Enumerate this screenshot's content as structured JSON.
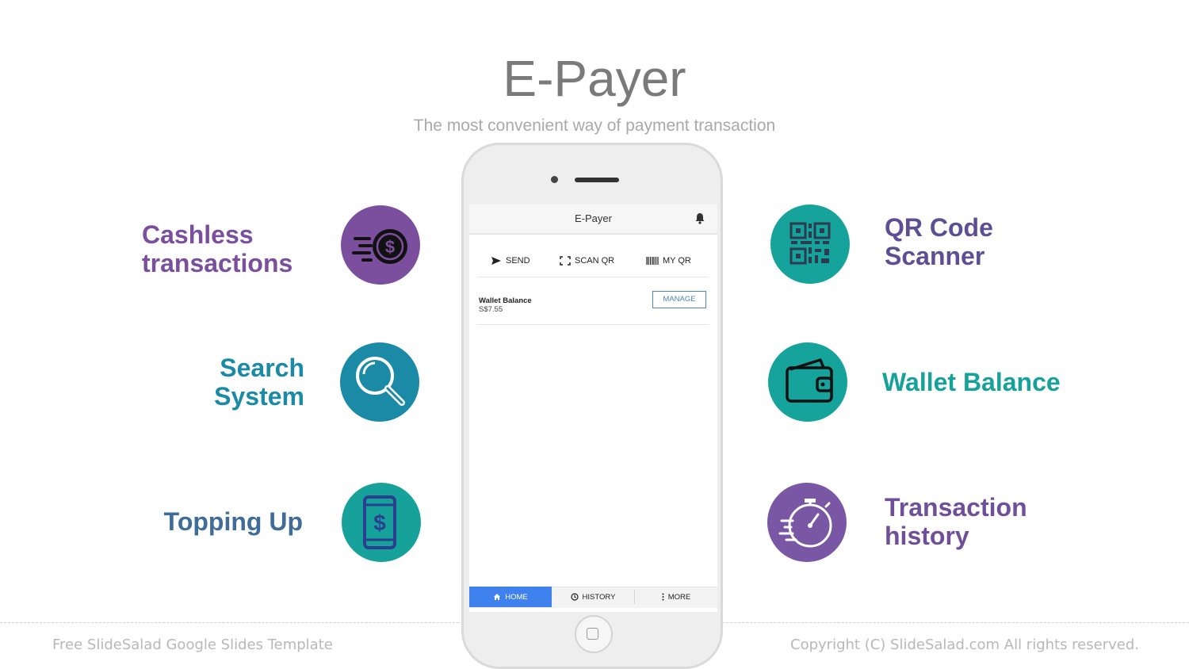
{
  "header": {
    "title": "E-Payer",
    "subtitle": "The most convenient way of payment transaction"
  },
  "features_left": [
    {
      "line1": "Cashless",
      "line2": "transactions",
      "color": "#7b4f9e",
      "icon": "fast-coin-icon",
      "circle_color": "#7b4f9e"
    },
    {
      "line1": "Search",
      "line2": "System",
      "color": "#1a8aa6",
      "icon": "magnifier-icon",
      "circle_color": "#1a8aa6"
    },
    {
      "line1": "Topping Up",
      "line2": "",
      "color": "#3f6c98",
      "icon": "phone-dollar-icon",
      "circle_color": "#16a19a"
    }
  ],
  "features_right": [
    {
      "line1": "QR Code",
      "line2": "Scanner",
      "color": "#5c4f95",
      "icon": "qr-code-icon",
      "circle_color": "#15a39b"
    },
    {
      "line1": "Wallet Balance",
      "line2": "",
      "color": "#16a19a",
      "icon": "wallet-icon",
      "circle_color": "#15a39b"
    },
    {
      "line1": "Transaction",
      "line2": "history",
      "color": "#6f4f9a",
      "icon": "stopwatch-icon",
      "circle_color": "#7a57a5"
    }
  ],
  "app": {
    "title": "E-Payer",
    "bell_icon": "bell-icon",
    "actions": [
      {
        "label": "SEND",
        "icon": "send-icon"
      },
      {
        "label": "SCAN QR",
        "icon": "scan-icon"
      },
      {
        "label": "MY QR",
        "icon": "barcode-icon"
      }
    ],
    "wallet_label": "Wallet Balance",
    "wallet_value": "S$7.55",
    "manage_label": "MANAGE",
    "tabs": [
      {
        "label": "HOME",
        "icon": "home-icon",
        "active": true
      },
      {
        "label": "HISTORY",
        "icon": "clock-icon",
        "active": false
      },
      {
        "label": "MORE",
        "icon": "more-icon",
        "active": false
      }
    ]
  },
  "footer": {
    "left": "Free SlideSalad Google Slides Template",
    "right": "Copyright (C) SlideSalad.com All rights reserved."
  }
}
